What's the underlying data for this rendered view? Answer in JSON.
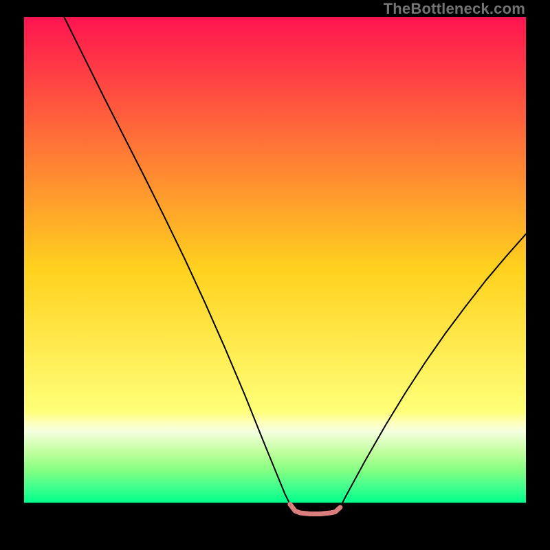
{
  "watermark": "TheBottleneck.com",
  "chart_data": {
    "type": "line",
    "title": "",
    "xlabel": "",
    "ylabel": "",
    "xlim": [
      0,
      100
    ],
    "ylim": [
      0,
      100
    ],
    "series": [
      {
        "name": "curve-black",
        "color": "#000000",
        "x": [
          8,
          12,
          16,
          20,
          24,
          28,
          32,
          36,
          40,
          44,
          48,
          52,
          53,
          54,
          58,
          62,
          63,
          64,
          68,
          72,
          76,
          80,
          84,
          88,
          92,
          96,
          100
        ],
        "y": [
          100,
          92,
          84,
          76.2,
          68.4,
          60.4,
          52.2,
          43.6,
          34.6,
          25.2,
          15.3,
          5.6,
          3.6,
          2.3,
          1.7,
          2.1,
          3.0,
          5.0,
          12.3,
          19.2,
          25.7,
          31.8,
          37.5,
          42.8,
          47.9,
          52.6,
          57.1
        ]
      },
      {
        "name": "curve-pink",
        "color": "#d97d7d",
        "x": [
          53,
          54,
          55,
          56,
          57,
          58,
          59,
          60,
          61,
          62,
          63
        ],
        "y": [
          3.6,
          2.3,
          1.9,
          1.8,
          1.7,
          1.7,
          1.7,
          1.8,
          1.9,
          2.1,
          3.0
        ]
      }
    ],
    "background_gradient": {
      "stops": [
        {
          "pos": 0.0,
          "color": "#ff1450"
        },
        {
          "pos": 0.5,
          "color": "#ffd21e"
        },
        {
          "pos": 0.78,
          "color": "#ffff78"
        },
        {
          "pos": 0.8,
          "color": "#ffffb4"
        },
        {
          "pos": 0.82,
          "color": "#f5ffe1"
        },
        {
          "pos": 0.84,
          "color": "#dbffbe"
        },
        {
          "pos": 0.86,
          "color": "#c2ffa0"
        },
        {
          "pos": 0.88,
          "color": "#a0ff8c"
        },
        {
          "pos": 0.9,
          "color": "#7dff82"
        },
        {
          "pos": 0.92,
          "color": "#55ff8c"
        },
        {
          "pos": 0.94,
          "color": "#2dff8c"
        },
        {
          "pos": 0.958,
          "color": "#05ff8c"
        },
        {
          "pos": 0.96,
          "color": "#05ff8c"
        },
        {
          "pos": 0.962,
          "color": "#000000"
        },
        {
          "pos": 1.0,
          "color": "#000000"
        }
      ]
    }
  }
}
